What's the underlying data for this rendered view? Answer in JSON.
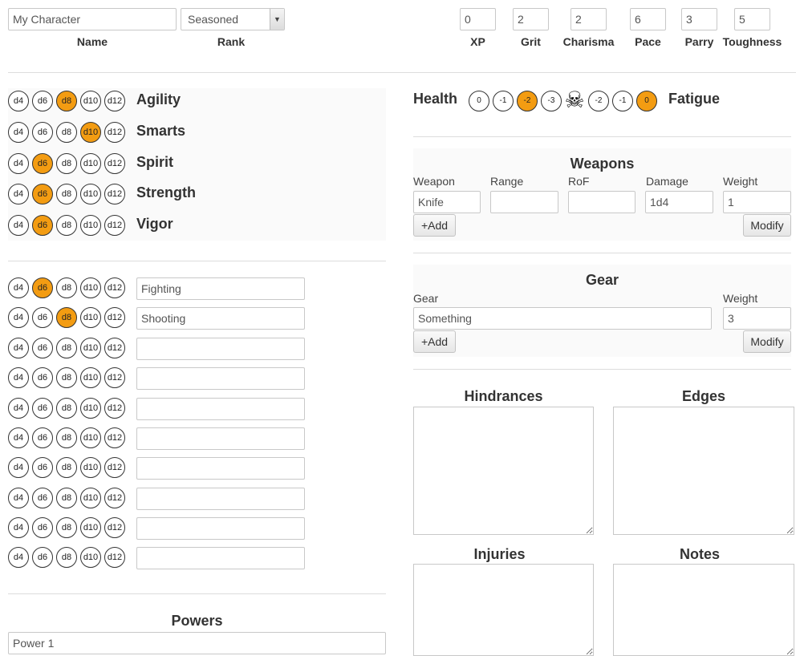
{
  "header": {
    "name_value": "My Character",
    "name_label": "Name",
    "rank_value": "Seasoned",
    "rank_label": "Rank",
    "stats": [
      {
        "label": "XP",
        "value": "0"
      },
      {
        "label": "Grit",
        "value": "2"
      },
      {
        "label": "Charisma",
        "value": "2"
      },
      {
        "label": "Pace",
        "value": "6"
      },
      {
        "label": "Parry",
        "value": "3"
      },
      {
        "label": "Toughness",
        "value": "5"
      }
    ]
  },
  "dice_labels": [
    "d4",
    "d6",
    "d8",
    "d10",
    "d12"
  ],
  "attributes": [
    {
      "name": "Agility",
      "selected": "d8"
    },
    {
      "name": "Smarts",
      "selected": "d10"
    },
    {
      "name": "Spirit",
      "selected": "d6"
    },
    {
      "name": "Strength",
      "selected": "d6"
    },
    {
      "name": "Vigor",
      "selected": "d6"
    }
  ],
  "skills": [
    {
      "name": "Fighting",
      "selected": "d6"
    },
    {
      "name": "Shooting",
      "selected": "d8"
    },
    {
      "name": "",
      "selected": ""
    },
    {
      "name": "",
      "selected": ""
    },
    {
      "name": "",
      "selected": ""
    },
    {
      "name": "",
      "selected": ""
    },
    {
      "name": "",
      "selected": ""
    },
    {
      "name": "",
      "selected": ""
    },
    {
      "name": "",
      "selected": ""
    },
    {
      "name": "",
      "selected": ""
    }
  ],
  "powers": {
    "title": "Powers",
    "items": [
      "Power 1"
    ]
  },
  "health": {
    "label": "Health",
    "wound_levels": [
      "0",
      "-1",
      "-2",
      "-3"
    ],
    "wound_selected": "-2",
    "fatigue_levels": [
      "-2",
      "-1",
      "0"
    ],
    "fatigue_selected": "0",
    "fatigue_label": "Fatigue",
    "incapacitated_icon": "skull-crossbones-icon",
    "incapacitated_glyph": "☠"
  },
  "weapons": {
    "title": "Weapons",
    "columns": [
      "Weapon",
      "Range",
      "RoF",
      "Damage",
      "Weight"
    ],
    "rows": [
      {
        "weapon": "Knife",
        "range": "",
        "rof": "",
        "damage": "1d4",
        "weight": "1"
      }
    ],
    "add_label": "+Add",
    "modify_label": "Modify"
  },
  "gear": {
    "title": "Gear",
    "columns": [
      "Gear",
      "Weight"
    ],
    "rows": [
      {
        "gear": "Something",
        "weight": "3"
      }
    ],
    "add_label": "+Add",
    "modify_label": "Modify"
  },
  "notes_sections": {
    "hindrances": "Hindrances",
    "edges": "Edges",
    "injuries": "Injuries",
    "notes": "Notes"
  },
  "colors": {
    "accent": "#f39c12",
    "border": "#c8c8c8"
  }
}
